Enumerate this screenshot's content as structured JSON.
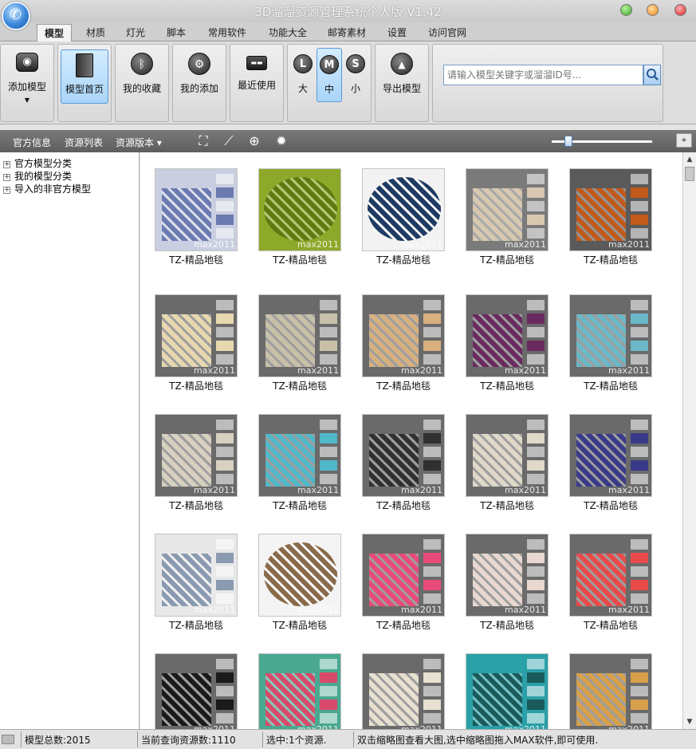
{
  "window": {
    "title": "3D溜溜资源管理系统个人版 V1.42"
  },
  "menu": {
    "tabs": [
      "模型",
      "材质",
      "灯光",
      "脚本",
      "常用软件",
      "功能大全",
      "邮寄素材",
      "设置",
      "访问官网"
    ],
    "active": 0
  },
  "ribbon": {
    "add_model": "添加模型",
    "model_home": "模型首页",
    "my_favorites": "我的收藏",
    "my_added": "我的添加",
    "recent": "最近使用",
    "size_large": "大",
    "size_medium": "中",
    "size_small": "小",
    "size_large_letter": "L",
    "size_medium_letter": "M",
    "size_small_letter": "S",
    "export_model": "导出模型",
    "search_placeholder": "请输入模型关键字或溜溜ID号..."
  },
  "toolbar": {
    "official_info": "官方信息",
    "resource_list": "资源列表",
    "resource_version": "资源版本 ▾",
    "zoom_level": 0.17
  },
  "tree": {
    "items": [
      "官方模型分类",
      "我的模型分类",
      "导入的非官方模型"
    ]
  },
  "grid": {
    "label": "TZ-精品地毯",
    "watermark": "max2011",
    "colors": [
      [
        "#c9cfe0",
        "#6b7ab0"
      ],
      [
        "#8ea82a",
        "#5f7a10"
      ],
      [
        "#f2f2f2",
        "#1d3b63"
      ],
      [
        "#7a7a7a",
        "#d8c8b0"
      ],
      [
        "#5a5a5a",
        "#c25a1a"
      ],
      [
        "#6a6a6a",
        "#e8d8b0"
      ],
      [
        "#6a6a6a",
        "#c8c0a8"
      ],
      [
        "#6a6a6a",
        "#d8b080"
      ],
      [
        "#6a6a6a",
        "#6a2a60"
      ],
      [
        "#6a6a6a",
        "#6ab8c8"
      ],
      [
        "#6a6a6a",
        "#d8d0c0"
      ],
      [
        "#6a6a6a",
        "#50b8c8"
      ],
      [
        "#6a6a6a",
        "#303030"
      ],
      [
        "#6a6a6a",
        "#e0d8c8"
      ],
      [
        "#6a6a6a",
        "#3a3a8a"
      ],
      [
        "#e8e8e8",
        "#8a9ab0"
      ],
      [
        "#f4f4f4",
        "#8a6a4a"
      ],
      [
        "#6a6a6a",
        "#e84a7a"
      ],
      [
        "#6a6a6a",
        "#e8d8d0"
      ],
      [
        "#6a6a6a",
        "#e84a4a"
      ],
      [
        "#6a6a6a",
        "#1a1a1a"
      ],
      [
        "#4aa890",
        "#d84a6a"
      ],
      [
        "#6a6a6a",
        "#e8e0d0"
      ],
      [
        "#2aa0a8",
        "#1a5a5a"
      ],
      [
        "#6a6a6a",
        "#d8a04a"
      ]
    ]
  },
  "status": {
    "total": "模型总数:2015",
    "current": "当前查询资源数:1110",
    "selected": "选中:1个资源.",
    "hint": "双击缩略图查看大图,选中缩略图拖入MAX软件,即可使用."
  }
}
